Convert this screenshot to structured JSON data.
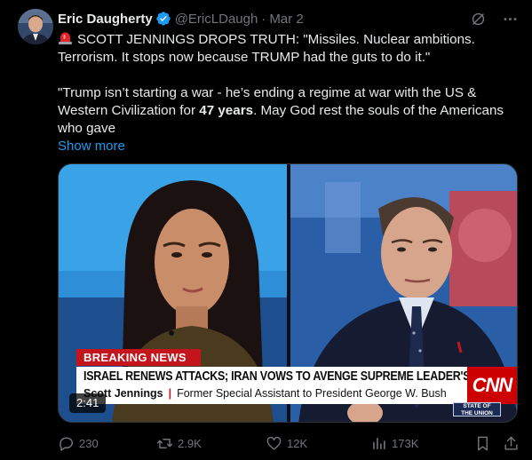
{
  "tweet": {
    "display_name": "Eric Daugherty",
    "handle": "@EricLDaugh",
    "separator": "·",
    "date": "Mar 2",
    "line1": "SCOTT JENNINGS DROPS TRUTH: \"Missiles. Nuclear ambitions. Terrorism. It stops now because TRUMP had the guts to do it.\"",
    "line2_pre": "\"Trump isn’t starting a war - he’s ending a regime at war with the US & Western Civilization for ",
    "line2_bold": "47 years",
    "line2_post": ". May God rest the souls of the Americans who gave",
    "show_more": "Show more",
    "icons": {
      "verified": "verified-badge-icon",
      "grok": "grok-icon",
      "more": "more-icon",
      "siren": "rotating-light-emoji"
    },
    "colors": {
      "accent": "#1d9bf0",
      "muted": "#71767b",
      "text": "#e7e9ea",
      "background": "#000000"
    }
  },
  "media": {
    "breaking": "BREAKING NEWS",
    "headline": "ISRAEL RENEWS ATTACKS; IRAN VOWS TO AVENGE SUPREME LEADER'S DEATH",
    "speaker_name": "Scott Jennings",
    "speaker_sep": "|",
    "speaker_title": "Former Special Assistant to President George W. Bush",
    "network_logo": "CNN",
    "show_bug_line1": "STATE OF",
    "show_bug_line2": "THE UNION",
    "duration": "2:41"
  },
  "actions": {
    "replies": "230",
    "reposts": "2.9K",
    "likes": "12K",
    "views": "173K"
  }
}
